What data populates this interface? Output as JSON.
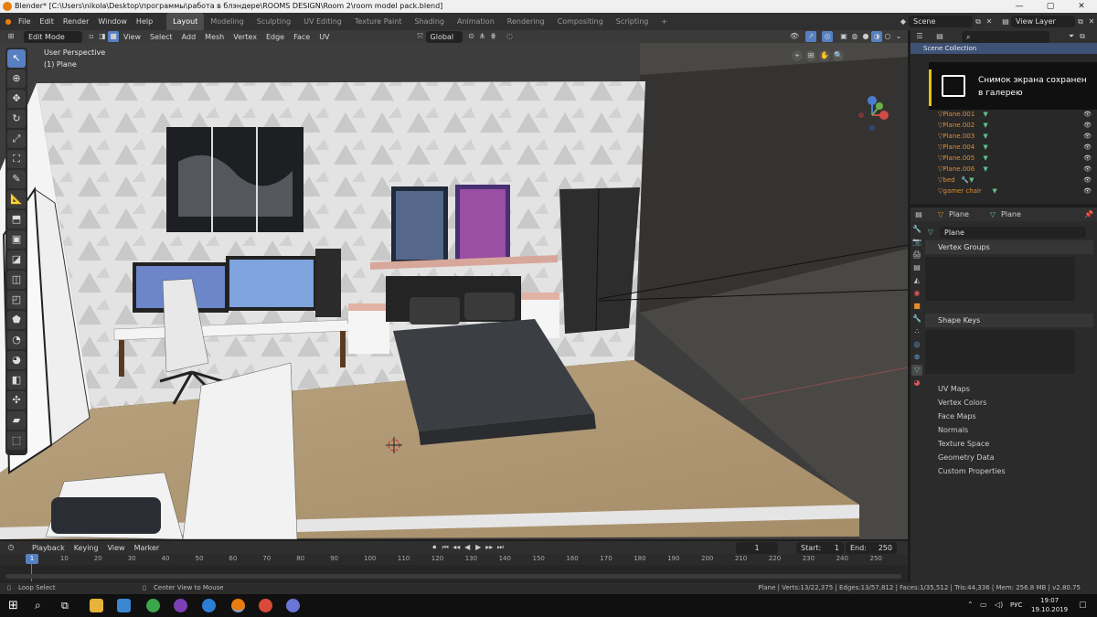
{
  "window": {
    "title": "Blender* [C:\\Users\\nikola\\Desktop\\программы\\работа в блэндере\\ROOMS DESIGN\\Room 2\\room model pack.blend]",
    "controls": [
      "—",
      "▢",
      "✕"
    ]
  },
  "topbar": {
    "menus": [
      "File",
      "Edit",
      "Render",
      "Window",
      "Help"
    ],
    "workspaces": [
      "Layout",
      "Modeling",
      "Sculpting",
      "UV Editing",
      "Texture Paint",
      "Shading",
      "Animation",
      "Rendering",
      "Compositing",
      "Scripting"
    ],
    "active_workspace": "Layout",
    "add_tab": "+",
    "scene_value": "Scene",
    "view_layer_value": "View Layer"
  },
  "viewport_header": {
    "mode": "Edit Mode",
    "menus": [
      "View",
      "Select",
      "Add",
      "Mesh",
      "Vertex",
      "Edge",
      "Face",
      "UV"
    ],
    "transform_orientation": "Global"
  },
  "viewport": {
    "perspective_label": "User Perspective",
    "object_label": "(1) Plane",
    "gizmo_axes": [
      "X",
      "Y",
      "Z"
    ]
  },
  "toast": {
    "line1": "Снимок экрана сохранен",
    "line2": "в галерею"
  },
  "outliner": {
    "search_placeholder": "",
    "collection": "Scene Collection",
    "items": [
      "Plane.001",
      "Plane.002",
      "Plane.003",
      "Plane.004",
      "Plane.005",
      "Plane.006",
      "bed",
      "gamer chair"
    ]
  },
  "properties": {
    "object_name": "Plane",
    "data_name": "Plane",
    "mesh_field": "Plane",
    "panels": {
      "vertex_groups": "Vertex Groups",
      "shape_keys": "Shape Keys"
    },
    "collapsed": [
      "UV Maps",
      "Vertex Colors",
      "Face Maps",
      "Normals",
      "Texture Space",
      "Geometry Data",
      "Custom Properties"
    ]
  },
  "timeline": {
    "menus": [
      "Playback",
      "Keying",
      "View",
      "Marker"
    ],
    "current_frame": "1",
    "start_label": "Start:",
    "start_value": "1",
    "end_label": "End:",
    "end_value": "250",
    "ruler": [
      "1",
      "10",
      "20",
      "30",
      "40",
      "50",
      "60",
      "70",
      "80",
      "90",
      "100",
      "110",
      "120",
      "130",
      "140",
      "150",
      "160",
      "170",
      "180",
      "190",
      "200",
      "210",
      "220",
      "230",
      "240",
      "250"
    ]
  },
  "statusbar": {
    "left": "Loop Select",
    "middle": "Center View to Mouse",
    "stats": "Plane | Verts:13/22,375 | Edges:13/57,812 | Faces:1/35,512 | Tris:44,336 | Mem: 256.8 MB | v2.80.75"
  },
  "taskbar": {
    "lang": "РУС",
    "time": "19:07",
    "date": "19.10.2019"
  },
  "colors": {
    "accent": "#5680c2",
    "orange": "#e38b2c",
    "panel": "#2b2b2b",
    "header": "#303030"
  }
}
